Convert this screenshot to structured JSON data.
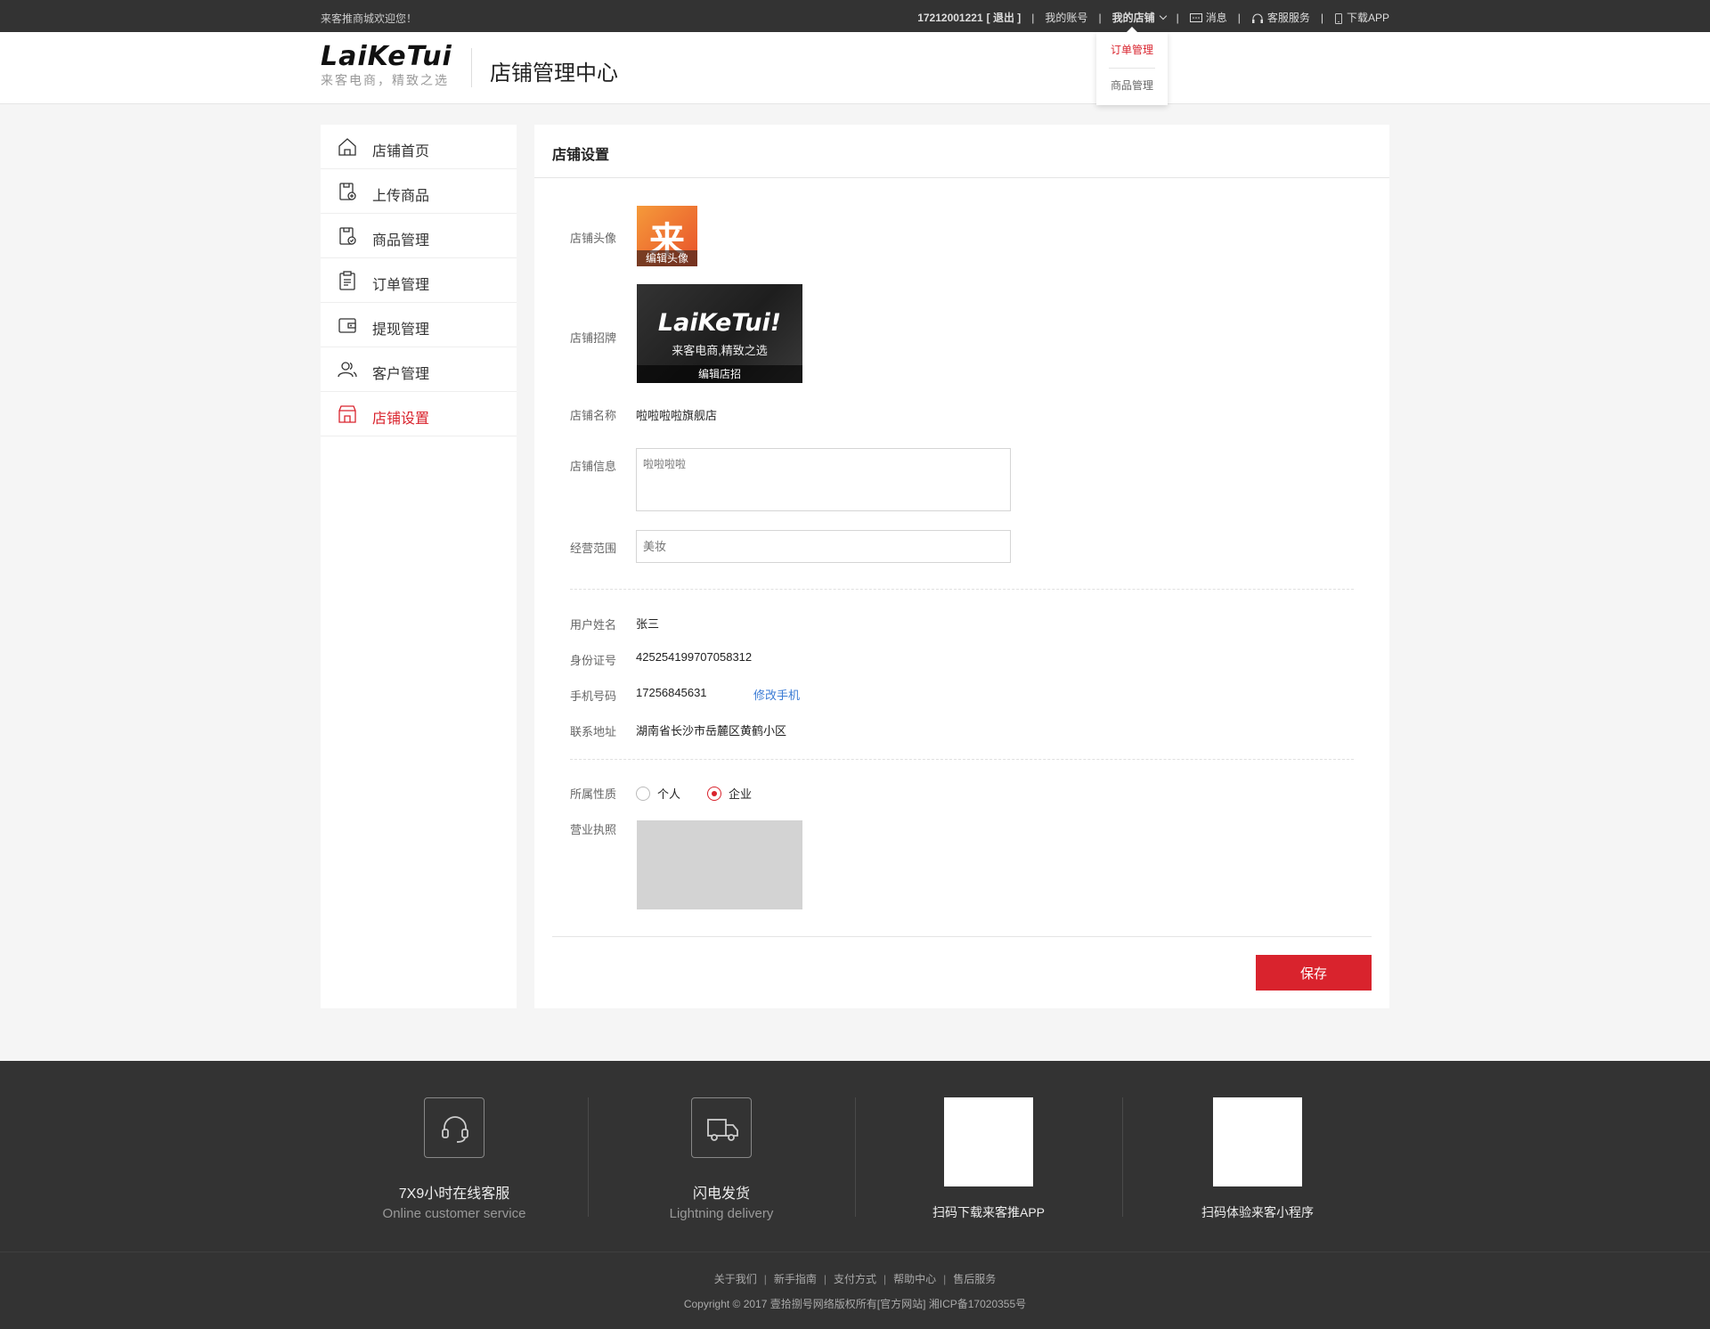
{
  "topbar": {
    "welcome": "来客推商城欢迎您！",
    "user_phone": "17212001221",
    "logout": "[ 退出 ]",
    "my_account": "我的账号",
    "my_store": "我的店铺",
    "messages": "消息",
    "customer_service": "客服服务",
    "download_app": "下载APP"
  },
  "dropdown": {
    "items": [
      "订单管理",
      "商品管理"
    ]
  },
  "header": {
    "logo_text": "LaiKeTui",
    "logo_slogan": "来客电商，精致之选",
    "title": "店铺管理中心"
  },
  "sidebar": {
    "items": [
      {
        "label": "店铺首页",
        "icon": "home-icon"
      },
      {
        "label": "上传商品",
        "icon": "upload-product-icon"
      },
      {
        "label": "商品管理",
        "icon": "product-manage-icon"
      },
      {
        "label": "订单管理",
        "icon": "clipboard-icon"
      },
      {
        "label": "提现管理",
        "icon": "wallet-icon"
      },
      {
        "label": "客户管理",
        "icon": "users-icon"
      },
      {
        "label": "店铺设置",
        "icon": "store-icon"
      }
    ],
    "active_index": 6,
    "active_color": "#d9232d"
  },
  "main": {
    "panel_title": "店铺设置",
    "avatar": {
      "label": "店铺头像",
      "char": "来",
      "caption": "编辑头像"
    },
    "banner": {
      "label": "店铺招牌",
      "logo": "LaiKeTui!",
      "slogan": "来客电商,精致之选",
      "caption": "编辑店招"
    },
    "store_name": {
      "label": "店铺名称",
      "value": "啦啦啦啦旗舰店"
    },
    "store_info": {
      "label": "店铺信息",
      "placeholder": "啦啦啦啦"
    },
    "business_scope": {
      "label": "经营范围",
      "placeholder": "美妆"
    },
    "user_name": {
      "label": "用户姓名",
      "value": "张三"
    },
    "id_number": {
      "label": "身份证号",
      "value": "425254199707058312"
    },
    "phone": {
      "label": "手机号码",
      "value": "17256845631",
      "modify": "修改手机"
    },
    "address": {
      "label": "联系地址",
      "value": "湖南省长沙市岳麓区黄鹤小区"
    },
    "nature": {
      "label": "所属性质",
      "options": [
        "个人",
        "企业"
      ],
      "selected": "企业"
    },
    "license": {
      "label": "营业执照"
    },
    "save": "保存"
  },
  "footer": {
    "services": [
      {
        "title": "7X9小时在线客服",
        "subtitle": "Online customer service",
        "icon": "headset-icon"
      },
      {
        "title": "闪电发货",
        "subtitle": "Lightning delivery",
        "icon": "truck-icon"
      }
    ],
    "qrs": [
      {
        "caption": "扫码下载来客推APP"
      },
      {
        "caption": "扫码体验来客小程序"
      }
    ],
    "links": [
      "关于我们",
      "新手指南",
      "支付方式",
      "帮助中心",
      "售后服务"
    ],
    "copyright": "Copyright © 2017 壹拾捌号网络版权所有[官方网站]   湘ICP备17020355号"
  },
  "colors": {
    "accent": "#d9232d",
    "link": "#3a7bd5",
    "dark_bar": "#333333"
  }
}
